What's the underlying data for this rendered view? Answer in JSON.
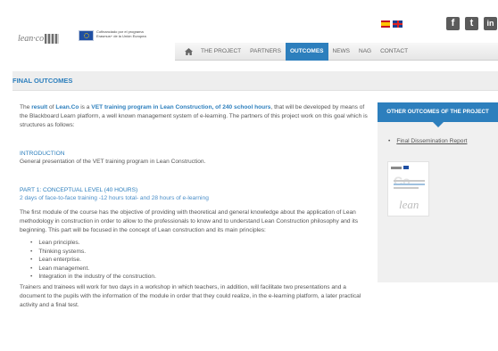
{
  "header": {
    "logo_text": "lean·co",
    "eu_text": "Cofinanciado por el programa Erasmus+ de la Unión Europea",
    "languages": [
      "es",
      "en"
    ],
    "social": [
      {
        "icon": "facebook-icon",
        "glyph": "f"
      },
      {
        "icon": "twitter-icon",
        "glyph": "t"
      },
      {
        "icon": "linkedin-icon",
        "glyph": "in"
      }
    ]
  },
  "nav": {
    "items": [
      "THE PROJECT",
      "PARTNERS",
      "OUTCOMES",
      "NEWS",
      "NAG",
      "CONTACT"
    ],
    "active": "OUTCOMES"
  },
  "page": {
    "title": "FINAL OUTCOMES"
  },
  "intro": {
    "t1": "The ",
    "t2": "result",
    "t3": " of ",
    "t4": "Lean.Co",
    "t5": " is a ",
    "t6": "VET training program in Lean Construction, of 240 school hours",
    "t7": ", that will be developed by means of the Blackboard Learn platform, a well known management system of e-learning. The partners of this project work on this goal which is structures as follows:"
  },
  "introduction": {
    "heading": "INTRODUCTION",
    "text": "General presentation of the VET training program in Lean Construction."
  },
  "part1": {
    "heading": "PART 1: CONCEPTUAL LEVEL (40 hours)",
    "subheading": "2 days of face-to-face training -12 hours total- and 28 hours of e-learning",
    "text": "The first module of the course has the objective of providing with theoretical and general knowledge about the application of Lean methodology in construction in order to allow to the professionals to know and to understand Lean Construction philosophy and its beginning. This part will be focused in the concept of Lean construction and its main principles:",
    "bullets": [
      "Lean principles.",
      "Thinking systems.",
      "Lean enterprise.",
      "Lean management.",
      "Integration in the industry of the construction."
    ],
    "closing": "Trainers and trainees will work for two days in a workshop in which teachers, in addition, will facilitate two presentations and a document to the pupils with the information of the module in order that they could realize, in the e-learning platform, a later practical activity and a final test."
  },
  "sidebar": {
    "heading": "OTHER OUTCOMES OF THE PROJECT",
    "link": "Final Dissemination Report",
    "thumb_brand": "lean",
    "thumb_mark": "Co"
  },
  "colors": {
    "accent": "#2d7fbd",
    "nav_bg": "#ececec",
    "sidebar_bg": "#f0f0f0"
  }
}
